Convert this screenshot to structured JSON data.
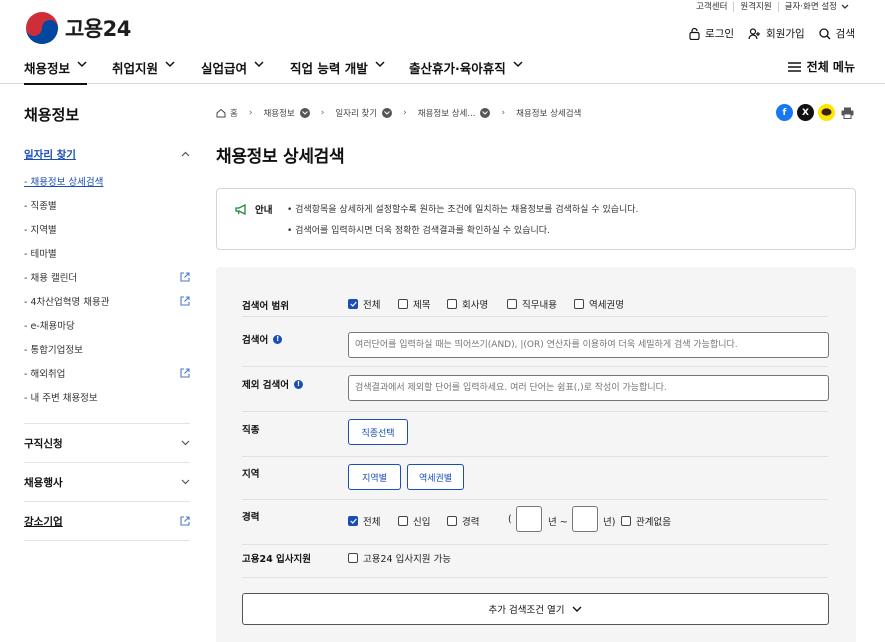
{
  "utility": [
    "고객센터",
    "원격지원",
    "글자·화면 설정"
  ],
  "logo": {
    "name": "고용24"
  },
  "account": {
    "login": "로그인",
    "signup": "회원가입",
    "search": "검색"
  },
  "gnb": {
    "items": [
      "채용정보",
      "취업지원",
      "실업급여",
      "직업 능력 개발",
      "출산휴가·육아휴직"
    ],
    "full_menu": "전체 메뉴"
  },
  "sidebar": {
    "title": "채용정보",
    "group1": "일자리 찾기",
    "items": [
      {
        "label": "- 채용정보 상세검색",
        "external": false
      },
      {
        "label": "- 직종별",
        "external": false
      },
      {
        "label": "- 지역별",
        "external": false
      },
      {
        "label": "- 테마별",
        "external": false
      },
      {
        "label": "- 채용 캘린더",
        "external": true
      },
      {
        "label": "- 4차산업혁명 채용관",
        "external": true
      },
      {
        "label": "- e-채용마당",
        "external": false
      },
      {
        "label": "- 통합기업정보",
        "external": false
      },
      {
        "label": "- 해외취업",
        "external": true
      },
      {
        "label": "- 내 주변 채용정보",
        "external": false
      }
    ],
    "group2": "구직신청",
    "group3": "채용행사",
    "group4": "강소기업"
  },
  "breadcrumb": [
    "홈",
    "채용정보",
    "일자리 찾기",
    "채용정보 상세...",
    "채용정보 상세검색"
  ],
  "page_title": "채용정보 상세검색",
  "notice": {
    "label": "안내",
    "lines": [
      "• 검색항목을 상세하게 설정할수록 원하는 조건에 일치하는 채용정보를 검색하실 수 있습니다.",
      "• 검색어를 입력하시면 더욱 정확한 검색결과를 확인하실 수 있습니다."
    ]
  },
  "form": {
    "scope": {
      "label": "검색어 범위",
      "options": [
        {
          "label": "전체",
          "checked": true
        },
        {
          "label": "제목",
          "checked": false
        },
        {
          "label": "회사명",
          "checked": false
        },
        {
          "label": "직무내용",
          "checked": false
        },
        {
          "label": "역세권명",
          "checked": false
        }
      ]
    },
    "keyword": {
      "label": "검색어",
      "placeholder": "여러단어를 입력하실 때는 띄어쓰기(AND), |(OR) 연산자를 이용하여 더욱 세밀하게 검색 가능합니다."
    },
    "exclude": {
      "label": "제외 검색어",
      "placeholder": "검색결과에서 제외할 단어를 입력하세요. 여러 단어는 쉼표(,)로 작성이 가능합니다."
    },
    "job": {
      "label": "직종",
      "button": "직종선택"
    },
    "region": {
      "label": "지역",
      "buttons": [
        "지역별",
        "역세권별"
      ]
    },
    "career": {
      "label": "경력",
      "options": [
        {
          "label": "전체",
          "checked": true
        },
        {
          "label": "신입",
          "checked": false
        },
        {
          "label": "경력",
          "checked": false
        }
      ],
      "open_paren": "(",
      "from_unit": "년 ~",
      "to_unit": "년)",
      "any": {
        "label": "관계없음",
        "checked": false
      }
    },
    "support": {
      "label": "고용24 입사지원",
      "option": {
        "label": "고용24 입사지원 가능",
        "checked": false
      }
    },
    "more_button": "추가 검색조건 열기"
  },
  "colors": {
    "accent": "#1a4db5",
    "facebook": "#1877f2",
    "x": "#111111",
    "kakao": "#fee500",
    "print": "#555555"
  }
}
